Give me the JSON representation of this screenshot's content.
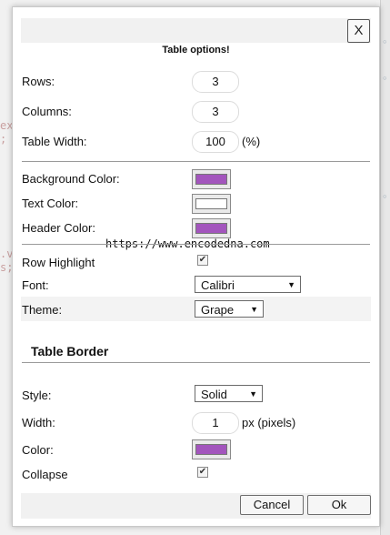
{
  "background_fragments": [
    "ex",
    ";",
    ".v",
    "s;"
  ],
  "dialog": {
    "close_label": "X",
    "title": "Table options!",
    "rows": {
      "label": "Rows:",
      "value": "3"
    },
    "columns": {
      "label": "Columns:",
      "value": "3"
    },
    "table_width": {
      "label": "Table Width:",
      "value": "100",
      "unit": "(%)"
    },
    "background_color": {
      "label": "Background Color:",
      "color": "#a355bd"
    },
    "text_color": {
      "label": "Text Color:",
      "color": "#ffffff"
    },
    "header_color": {
      "label": "Header Color:",
      "color": "#a355bd"
    },
    "watermark": "https://www.encodedna.com",
    "row_highlight": {
      "label": "Row Highlight",
      "checked": true
    },
    "font": {
      "label": "Font:",
      "value": "Calibri"
    },
    "theme": {
      "label": "Theme:",
      "value": "Grape"
    },
    "border_section": {
      "heading": "Table Border",
      "style": {
        "label": "Style:",
        "value": "Solid"
      },
      "width": {
        "label": "Width:",
        "value": "1",
        "unit": "px (pixels)"
      },
      "color": {
        "label": "Color:",
        "color": "#a355bd"
      },
      "collapse": {
        "label": "Collapse",
        "checked": true
      }
    },
    "buttons": {
      "cancel": "Cancel",
      "ok": "Ok"
    }
  }
}
